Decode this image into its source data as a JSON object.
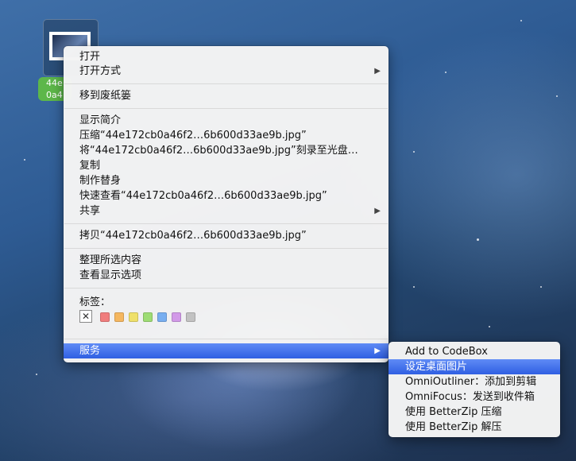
{
  "desktop": {
    "file": {
      "label_line1": "44e",
      "label_line2": "0a4"
    }
  },
  "context_menu": {
    "items": [
      {
        "label": "打开"
      },
      {
        "label": "打开方式"
      },
      {
        "label": "移到废纸篓"
      },
      {
        "label": "显示简介"
      },
      {
        "label": "压缩“44e172cb0a46f2…6b600d33ae9b.jpg”"
      },
      {
        "label": "将“44e172cb0a46f2…6b600d33ae9b.jpg”刻录至光盘…"
      },
      {
        "label": "复制"
      },
      {
        "label": "制作替身"
      },
      {
        "label": "快速查看“44e172cb0a46f2…6b600d33ae9b.jpg”"
      },
      {
        "label": "共享"
      },
      {
        "label": "拷贝“44e172cb0a46f2…6b600d33ae9b.jpg”"
      },
      {
        "label": "整理所选内容"
      },
      {
        "label": "查看显示选项"
      },
      {
        "label": "服务"
      }
    ],
    "tags_label": "标签：",
    "tag_colors": [
      "#f07d7d",
      "#f5b760",
      "#efe06a",
      "#9edc74",
      "#78aef0",
      "#d29ae8",
      "#c2c2c2"
    ],
    "submenu_arrow": "▶"
  },
  "services_submenu": {
    "items": [
      {
        "label": "Add to CodeBox"
      },
      {
        "label": "设定桌面图片"
      },
      {
        "label": "OmniOutliner：添加到剪辑"
      },
      {
        "label": "OmniFocus：发送到收件箱"
      },
      {
        "label": "使用 BetterZip 压缩"
      },
      {
        "label": "使用 BetterZip 解压"
      }
    ]
  },
  "colors": {
    "selection": "#3b6ef0",
    "file_label": "#5db74a"
  }
}
